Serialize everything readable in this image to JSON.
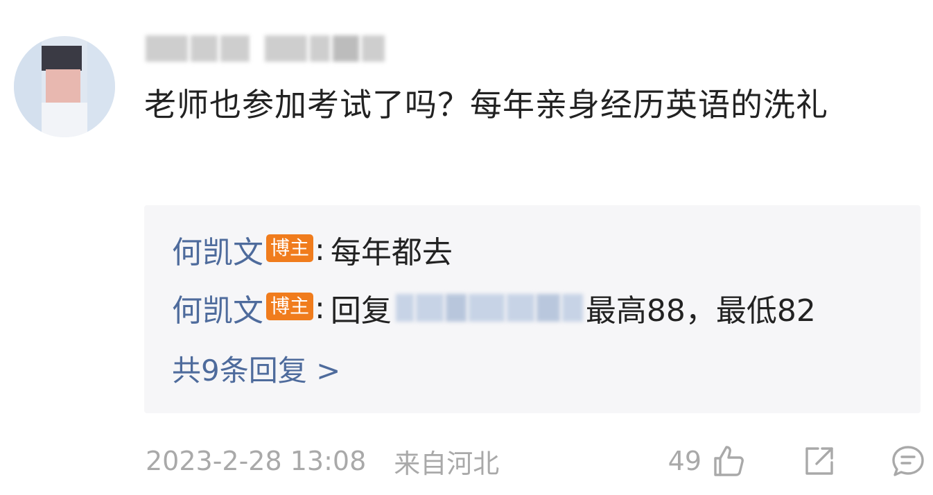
{
  "comment": {
    "text": "老师也参加考试了吗？每年亲身经历英语的洗礼",
    "timestamp": "2023-2-28 13:08",
    "location": "来自河北",
    "likes": "49"
  },
  "replies": [
    {
      "author": "何凯文",
      "badge": "博主",
      "colon": ":",
      "text": "每年都去"
    },
    {
      "author": "何凯文",
      "badge": "博主",
      "colon": ":",
      "prefix": "回复",
      "text": "最高88，最低82"
    }
  ],
  "more_replies": "共9条回复 >",
  "icons": {
    "like": "thumbs-up-icon",
    "share": "share-icon",
    "comment": "comment-icon"
  },
  "colors": {
    "link": "#4e6b9c",
    "badge": "#f07c1d",
    "reply_bg": "#f6f6f8",
    "meta_text": "#a9a9a9"
  }
}
